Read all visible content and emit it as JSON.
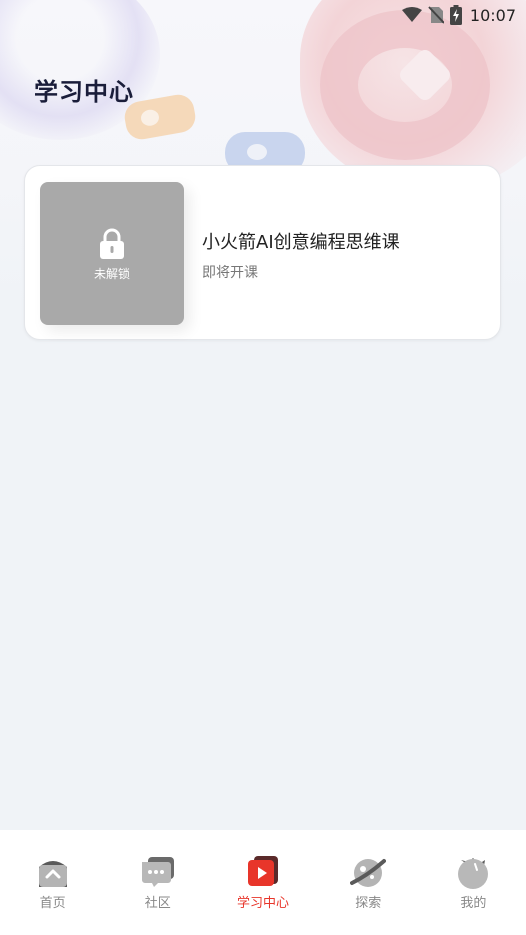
{
  "status_bar": {
    "time": "10:07"
  },
  "page": {
    "title": "学习中心"
  },
  "course": {
    "title": "小火箭AI创意编程思维课",
    "status": "即将开课",
    "lock_label": "未解锁"
  },
  "nav": {
    "items": [
      {
        "label": "首页",
        "icon": "home-icon",
        "active": false
      },
      {
        "label": "社区",
        "icon": "community-icon",
        "active": false
      },
      {
        "label": "学习中心",
        "icon": "learning-center-icon",
        "active": true
      },
      {
        "label": "探索",
        "icon": "explore-icon",
        "active": false
      },
      {
        "label": "我的",
        "icon": "profile-icon",
        "active": false
      }
    ]
  },
  "colors": {
    "accent": "#e8352a",
    "inactive": "#888888",
    "title": "#1a1d3a",
    "thumb": "#a9a9a9"
  }
}
